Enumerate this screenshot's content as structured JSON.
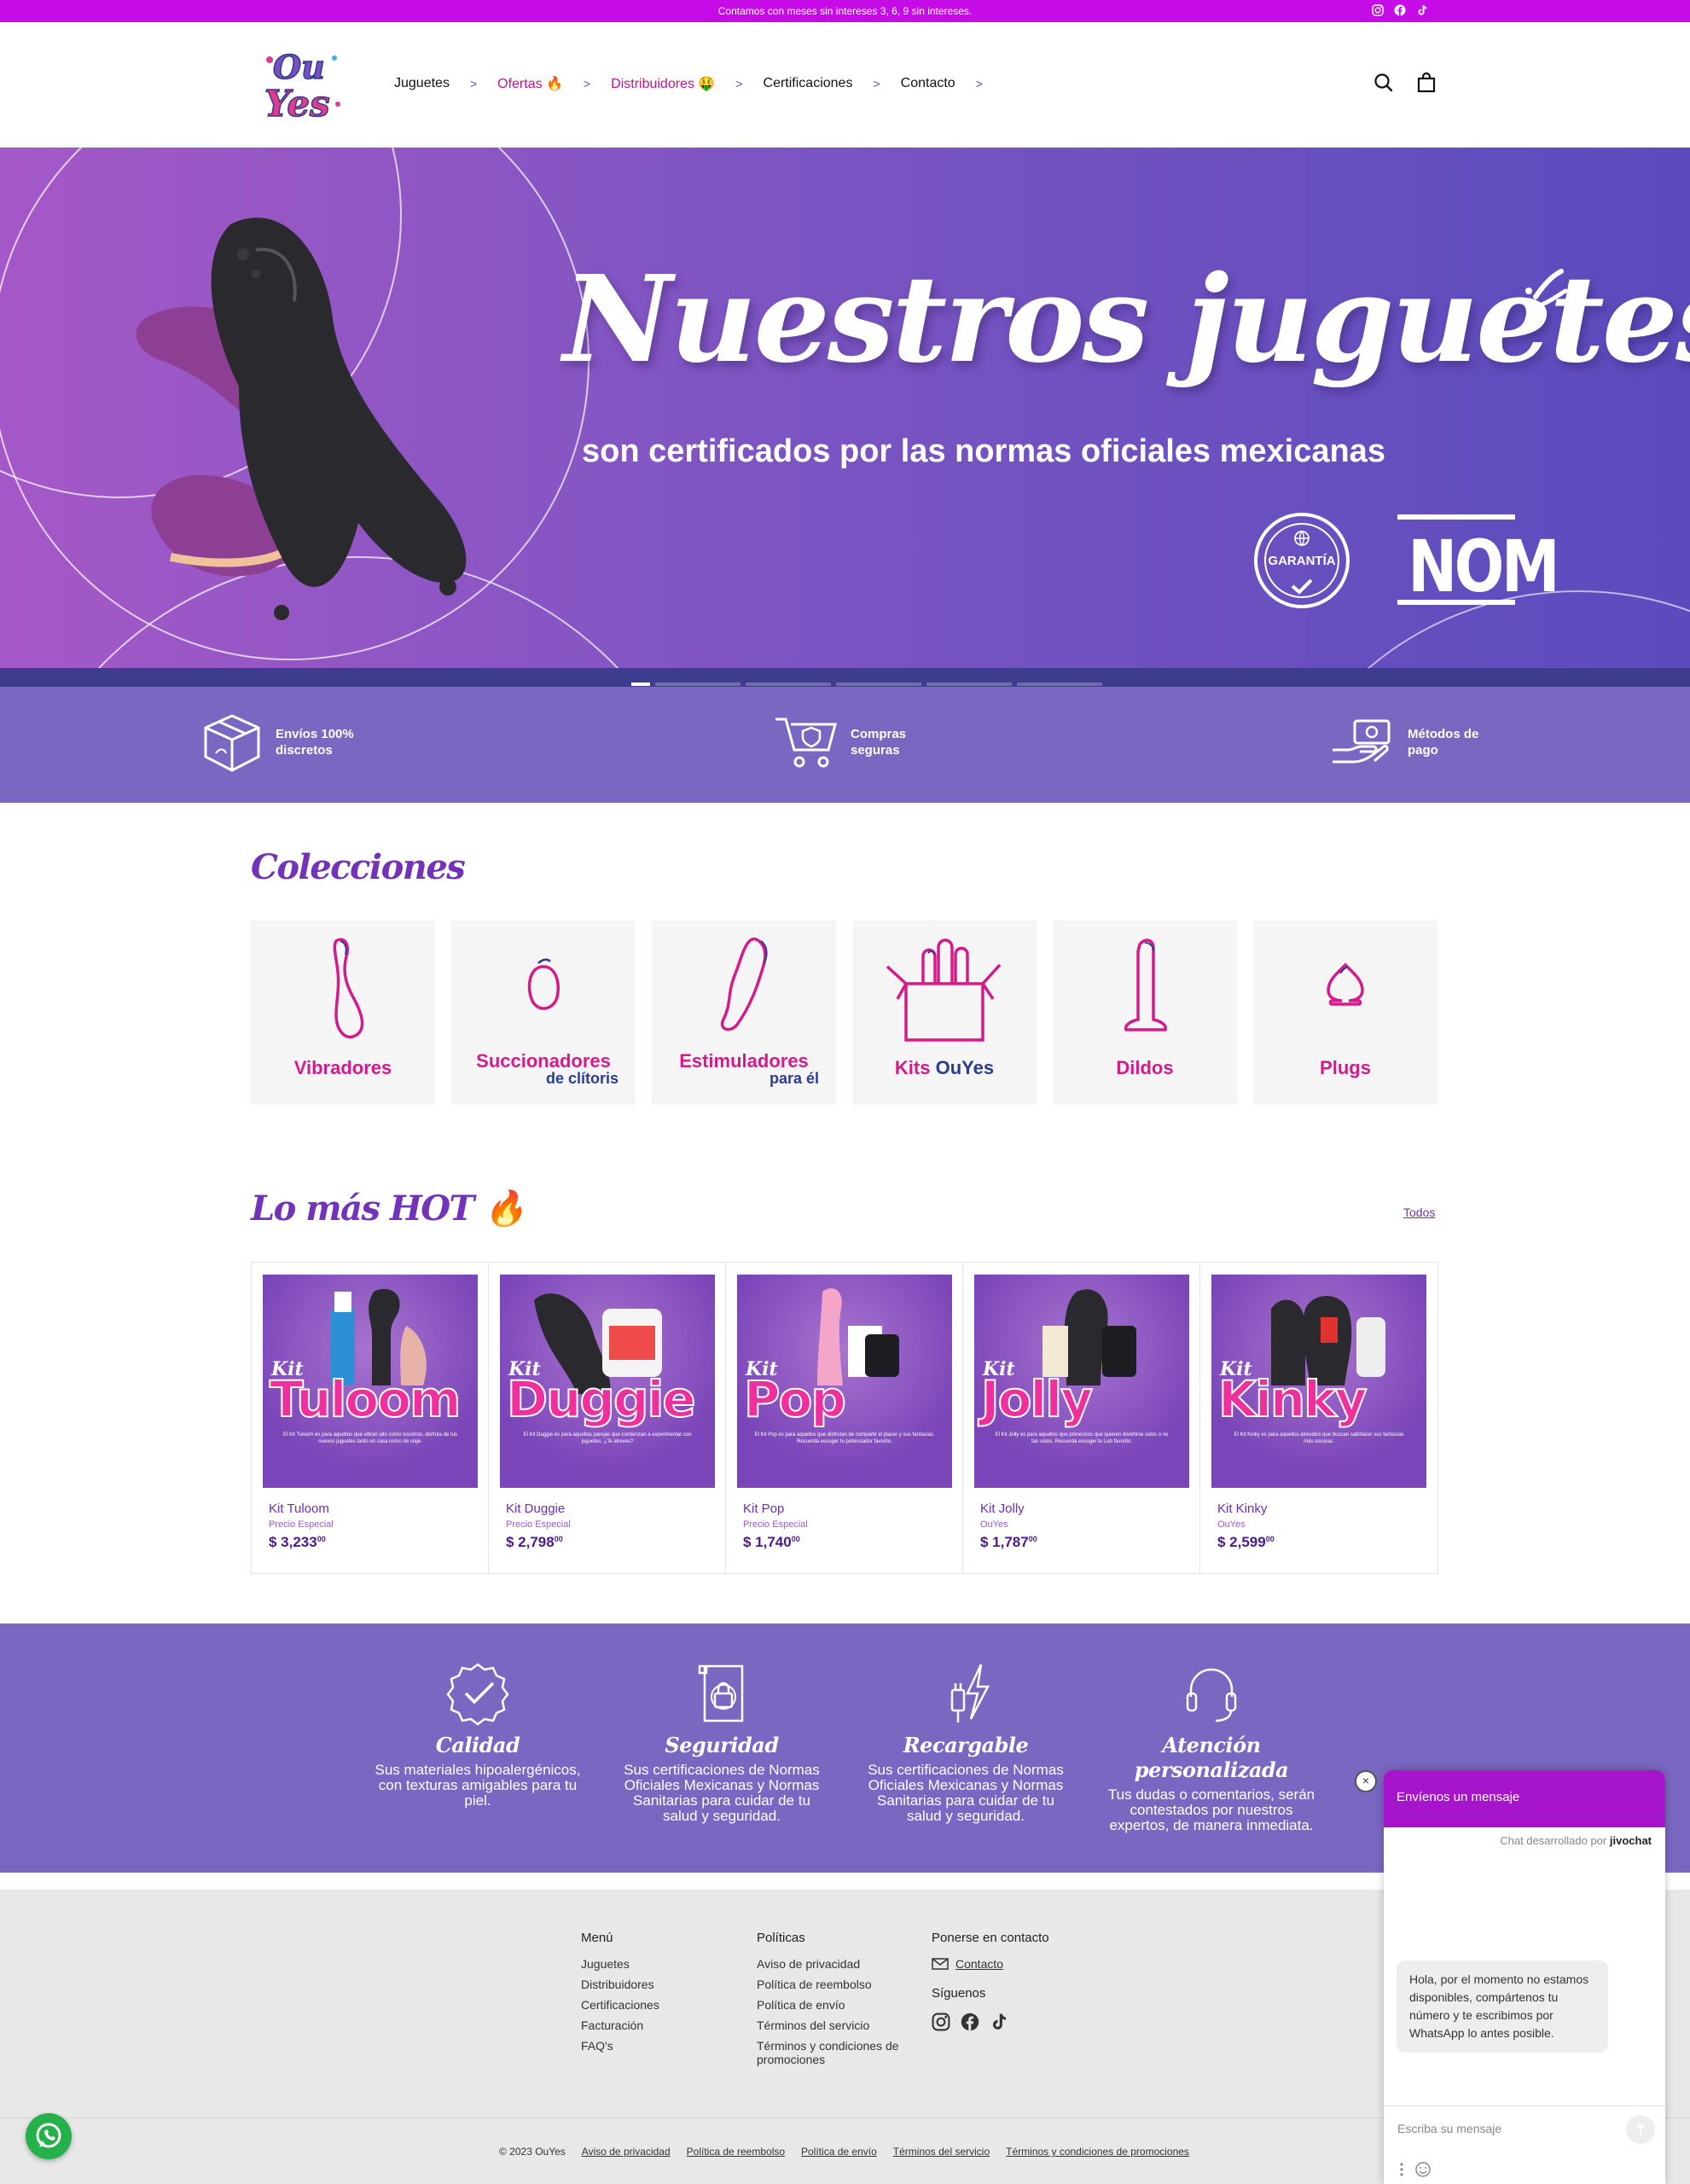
{
  "announcement": {
    "text": "Contamos con meses sin intereses 3, 6, 9 sin intereses."
  },
  "header": {
    "logo_text": "OuYes",
    "nav": [
      {
        "label": "Juguetes",
        "style": "normal"
      },
      {
        "label": "Ofertas 🔥",
        "style": "hot"
      },
      {
        "label": "Distribuidores 🤑",
        "style": "hot"
      },
      {
        "label": "Certificaciones",
        "style": "normal"
      },
      {
        "label": "Contacto",
        "style": "normal"
      }
    ],
    "nav_chevron": ">"
  },
  "hero": {
    "title": "Nuestros juguetes",
    "subtitle": "son certificados  por las normas oficiales mexicanas",
    "badge_garantia": "GARANTÍA",
    "badge_nom": "NOM",
    "slides": 6,
    "active_slide": 1
  },
  "features": [
    {
      "label": "Envíos 100% discretos",
      "icon": "box-icon"
    },
    {
      "label": "Compras seguras",
      "icon": "cart-shield-icon"
    },
    {
      "label": "Métodos de pago",
      "icon": "payment-hand-icon"
    }
  ],
  "colecciones": {
    "title": "Colecciones",
    "items": [
      {
        "line1": "Vibradores",
        "line2": ""
      },
      {
        "line1": "Succionadores",
        "line2": "de clítoris"
      },
      {
        "line1": "Estimuladores",
        "line2": "para él"
      },
      {
        "line1": "Kits",
        "line1b": "OuYes",
        "line2": ""
      },
      {
        "line1": "Dildos",
        "line2": ""
      },
      {
        "line1": "Plugs",
        "line2": ""
      }
    ]
  },
  "hot": {
    "title": "Lo más HOT",
    "emoji": "🔥",
    "all_link": "Todos",
    "products": [
      {
        "image_kit": "Kit",
        "image_name": "Tuloom",
        "name": "Kit Tuloom",
        "vendor": "Precio Especial",
        "price": "$ 3,233",
        "cents": "00"
      },
      {
        "image_kit": "Kit",
        "image_name": "Duggie",
        "name": "Kit Duggie",
        "vendor": "Precio Especial",
        "price": "$ 2,798",
        "cents": "00"
      },
      {
        "image_kit": "Kit",
        "image_name": "Pop",
        "name": "Kit Pop",
        "vendor": "Precio Especial",
        "price": "$ 1,740",
        "cents": "00"
      },
      {
        "image_kit": "Kit",
        "image_name": "Jolly",
        "name": "Kit Jolly",
        "vendor": "OuYes",
        "price": "$ 1,787",
        "cents": "00"
      },
      {
        "image_kit": "Kit",
        "image_name": "Kinky",
        "name": "Kit Kinky",
        "vendor": "OuYes",
        "price": "$ 2,599",
        "cents": "00"
      }
    ]
  },
  "values": [
    {
      "title": "Calidad",
      "text": "Sus materiales hipoalergénicos, con texturas amigables para tu piel."
    },
    {
      "title": "Seguridad",
      "text": "Sus certificaciones de Normas Oficiales Mexicanas y Normas Sanitarias para cuidar de tu salud y seguridad."
    },
    {
      "title": "Recargable",
      "text": "Sus certificaciones de Normas Oficiales Mexicanas y Normas Sanitarias para cuidar de tu salud y seguridad."
    },
    {
      "title": "Atención personalizada",
      "text": "Tus dudas o comentarios, serán contestados por nuestros expertos, de manera inmediata."
    }
  ],
  "footer": {
    "menu": {
      "title": "Menú",
      "links": [
        "Juguetes",
        "Distribuidores",
        "Certificaciones",
        "Facturación",
        "FAQ's"
      ]
    },
    "policies": {
      "title": "Políticas",
      "links": [
        "Aviso de privacidad",
        "Política de reembolso",
        "Política de envío",
        "Términos del servicio",
        "Términos y condiciones de promociones"
      ]
    },
    "contact": {
      "title": "Ponerse en contacto",
      "link": "Contacto",
      "follow": "Síguenos"
    },
    "copyright": "© 2023 OuYes",
    "bottom_links": [
      "Aviso de privacidad",
      "Política de reembolso",
      "Política de envío",
      "Términos del servicio",
      "Términos y condiciones de promociones"
    ]
  },
  "chat": {
    "header": "Envíenos un mensaje",
    "developed_by": "Chat desarrollado por",
    "brand": "jivochat",
    "message": "Hola, por el momento no estamos disponibles, compártenos tu número y te escribimos por WhatsApp lo antes posible.",
    "input_placeholder": "Escriba su mensaje",
    "close": "×"
  },
  "colors": {
    "brand_purple": "#7233b8",
    "magenta": "#c60ce6",
    "pink": "#d41b8a",
    "band": "#7a67c2",
    "whatsapp": "#25b14a"
  }
}
